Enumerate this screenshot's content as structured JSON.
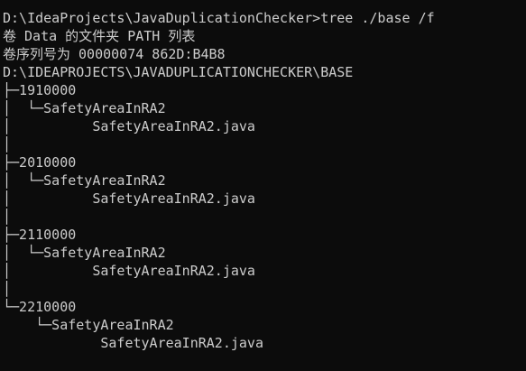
{
  "console": {
    "lines": [
      "D:\\IdeaProjects\\JavaDuplicationChecker>tree ./base /f",
      "卷 Data 的文件夹 PATH 列表",
      "卷序列号为 00000074 862D:B4B8",
      "D:\\IDEAPROJECTS\\JAVADUPLICATIONCHECKER\\BASE",
      "├─1910000",
      "│  └─SafetyAreaInRA2",
      "│          SafetyAreaInRA2.java",
      "│",
      "├─2010000",
      "│  └─SafetyAreaInRA2",
      "│          SafetyAreaInRA2.java",
      "│",
      "├─2110000",
      "│  └─SafetyAreaInRA2",
      "│          SafetyAreaInRA2.java",
      "│",
      "└─2210000",
      "    └─SafetyAreaInRA2",
      "            SafetyAreaInRA2.java"
    ]
  },
  "colors": {
    "background": "#0c0c0c",
    "text": "#cccccc"
  }
}
